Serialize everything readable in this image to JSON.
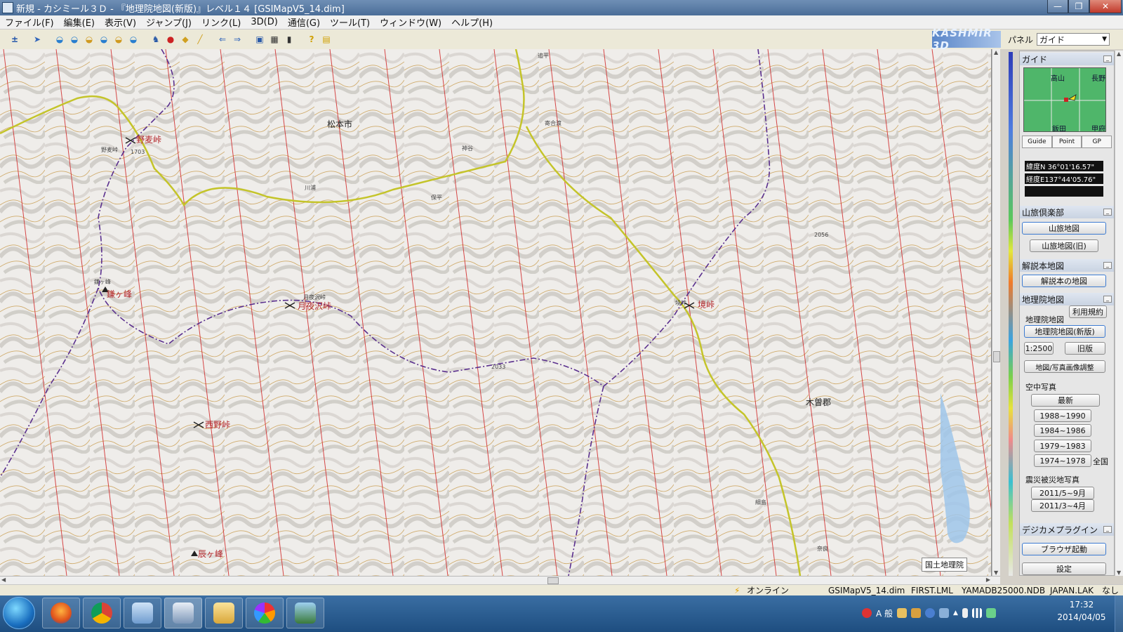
{
  "window": {
    "title": "新規 - カシミール３Ｄ - 『地理院地図(新版)』レベル１４ [GSIMapV5_14.dim]"
  },
  "menu": [
    "ファイル(F)",
    "編集(E)",
    "表示(V)",
    "ジャンプ(J)",
    "リンク(L)",
    "3D(D)",
    "通信(G)",
    "ツール(T)",
    "ウィンドウ(W)",
    "ヘルプ(H)"
  ],
  "toolbar": {
    "brand": "KASHMIR 3D"
  },
  "panel": {
    "label": "パネル",
    "selected": "ガイド"
  },
  "map": {
    "labels": {
      "matsumoto": "松本市",
      "nomugi_pass": "野麦峠",
      "nomugi_small": "野麦峠",
      "nabekamurine": "鎌ヶ峰",
      "nabe_small": "鎌ヶ峰",
      "tsukiyosawa": "月夜沢峠",
      "tsukiyo_small": "月夜沢峠",
      "sakai_pass": "境峠",
      "sakai_small": "境峠",
      "nishino_pass": "西野峠",
      "tatsugamine": "辰ヶ峰",
      "kiso_gun": "木曽郡",
      "odaira": "追平",
      "kamikochi": "寄合渡",
      "shindai": "神谷",
      "kawaura": "川浦",
      "hora": "保平",
      "elev_1703": "1703",
      "elev_2033": "2033",
      "elev_2056": "2056",
      "hosojima": "細島",
      "yabuhara": "奈良"
    },
    "credit": "国土地理院"
  },
  "guide": {
    "title": "ガイド",
    "map_labels": {
      "takayama": "高山",
      "nagano": "長野",
      "iida": "飯田",
      "kofu": "甲府"
    },
    "tabs": [
      "Guide",
      "Point",
      "GP"
    ],
    "lat": "緯度N 36°01'16.57\"",
    "lon": "経度E137°44'05.76\""
  },
  "sanryo": {
    "title": "山旅倶楽部",
    "buttons": [
      "山旅地図",
      "山旅地図(旧)"
    ]
  },
  "kaisetsu": {
    "title": "解説本地図",
    "button": "解説本の地図"
  },
  "chiriin": {
    "title": "地理院地図",
    "terms": "利用規約",
    "sub_label": "地理院地図",
    "main_button": "地理院地図(新版)",
    "btn_1_2500": "1:2500",
    "btn_old": "旧版",
    "adjust": "地図/写真画像調整",
    "aerial_label": "空中写真",
    "aerial_latest": "最新",
    "aerial_years": [
      "1988~1990",
      "1984~1986",
      "1979~1983",
      "1974~1978"
    ],
    "nationwide": "全国",
    "disaster_label": "震災被災地写真",
    "disaster_years": [
      "2011/5~9月",
      "2011/3~4月"
    ]
  },
  "digicam": {
    "title": "デジカメプラグイン",
    "browser": "ブラウザ起動",
    "settings": "設定"
  },
  "status": {
    "online": "オンライン",
    "files": [
      "GSIMapV5_14.dim",
      "FIRST.LML",
      "YAMADB25000.NDB",
      "JAPAN.LAK",
      "なし"
    ]
  },
  "taskbar": {
    "ime": "A 般",
    "time": "17:32",
    "date": "2014/04/05"
  },
  "colors": {
    "grid_red": "#d12a2a",
    "contour": "#c79a4a",
    "road_yellow": "#c4c42a",
    "boundary_purple": "#5a2f8e"
  }
}
